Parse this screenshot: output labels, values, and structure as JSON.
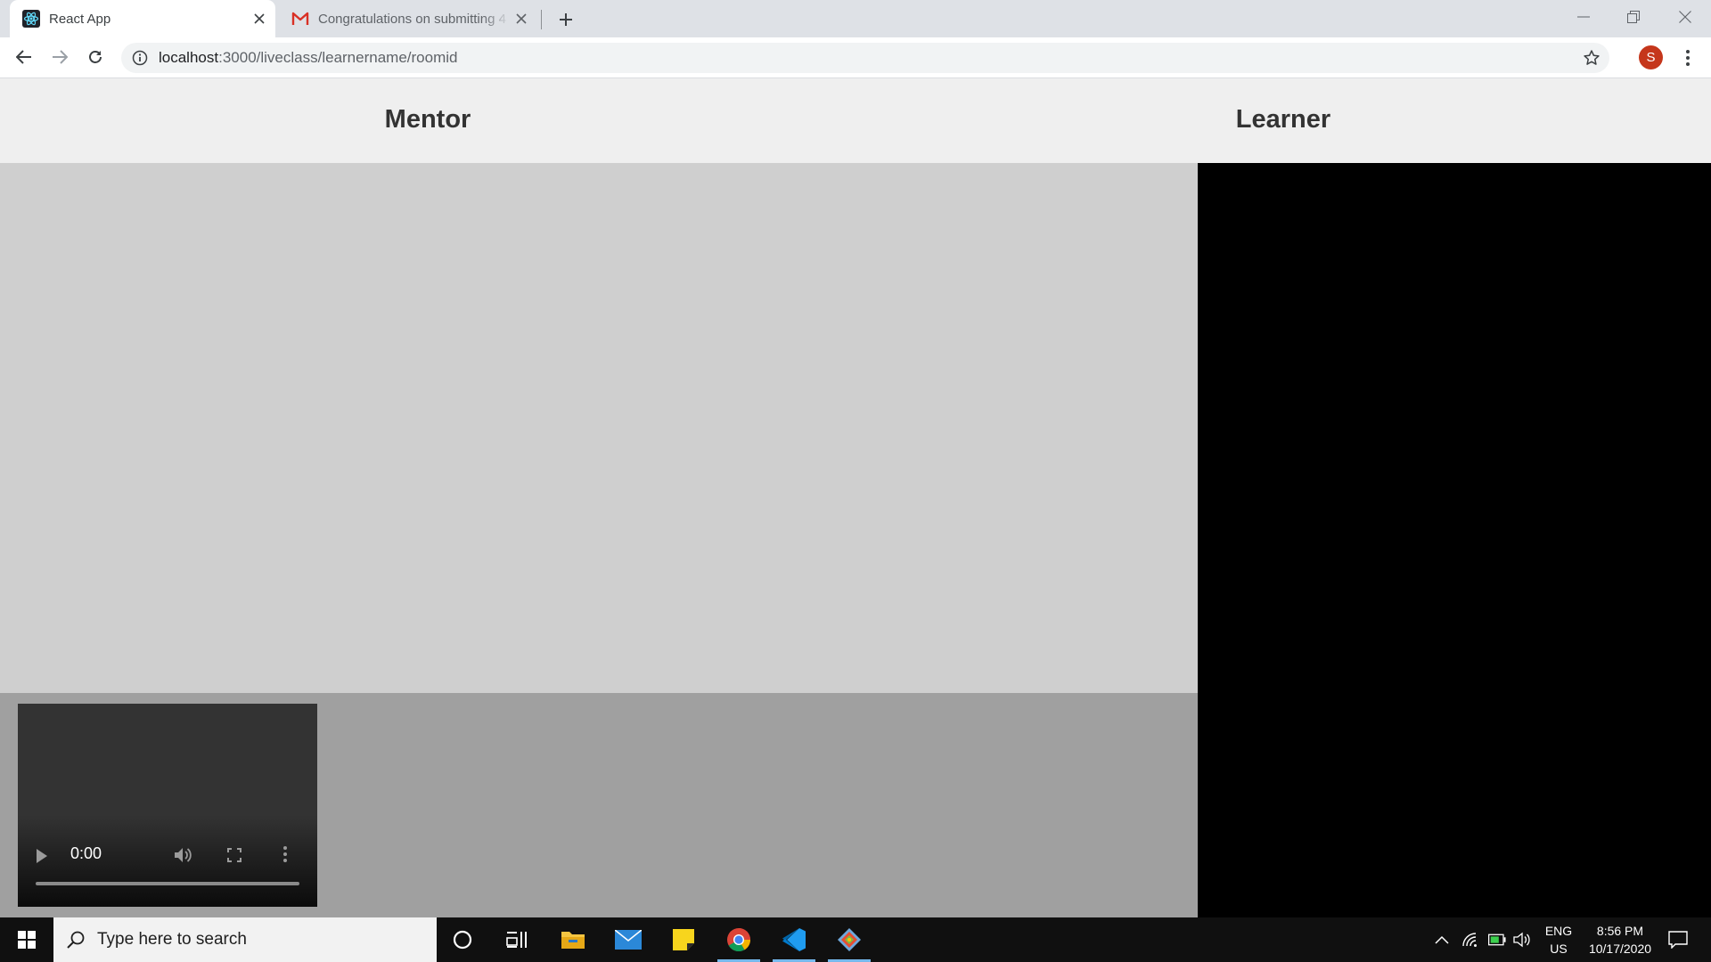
{
  "browser": {
    "tabs": [
      {
        "title": "React App",
        "favicon": "react-icon",
        "active": true
      },
      {
        "title": "Congratulations on submitting 4",
        "favicon": "gmail-icon",
        "active": false
      }
    ],
    "address": {
      "host": "localhost",
      "rest": ":3000/liveclass/learnername/roomid"
    },
    "profile_initial": "S",
    "colors": {
      "tabstrip": "#dee1e6",
      "avatar": "#c5361b"
    }
  },
  "page": {
    "mentor_heading": "Mentor",
    "learner_heading": "Learner",
    "colors": {
      "background": "#efefef",
      "mentor_area": "#cfcfcf",
      "mentor_bottom": "#a0a0a0",
      "learner_video": "#000000"
    },
    "video": {
      "time": "0:00",
      "progress": 0
    }
  },
  "taskbar": {
    "search_placeholder": "Type here to search",
    "pinned_apps": [
      "cortana-icon",
      "task-view-icon",
      "file-explorer-icon",
      "mail-icon",
      "sticky-notes-icon",
      "chrome-icon",
      "vscode-icon",
      "git-icon"
    ],
    "language_top": "ENG",
    "language_bottom": "US",
    "time": "8:56 PM",
    "date": "10/17/2020",
    "accent": "#76b9ed"
  }
}
